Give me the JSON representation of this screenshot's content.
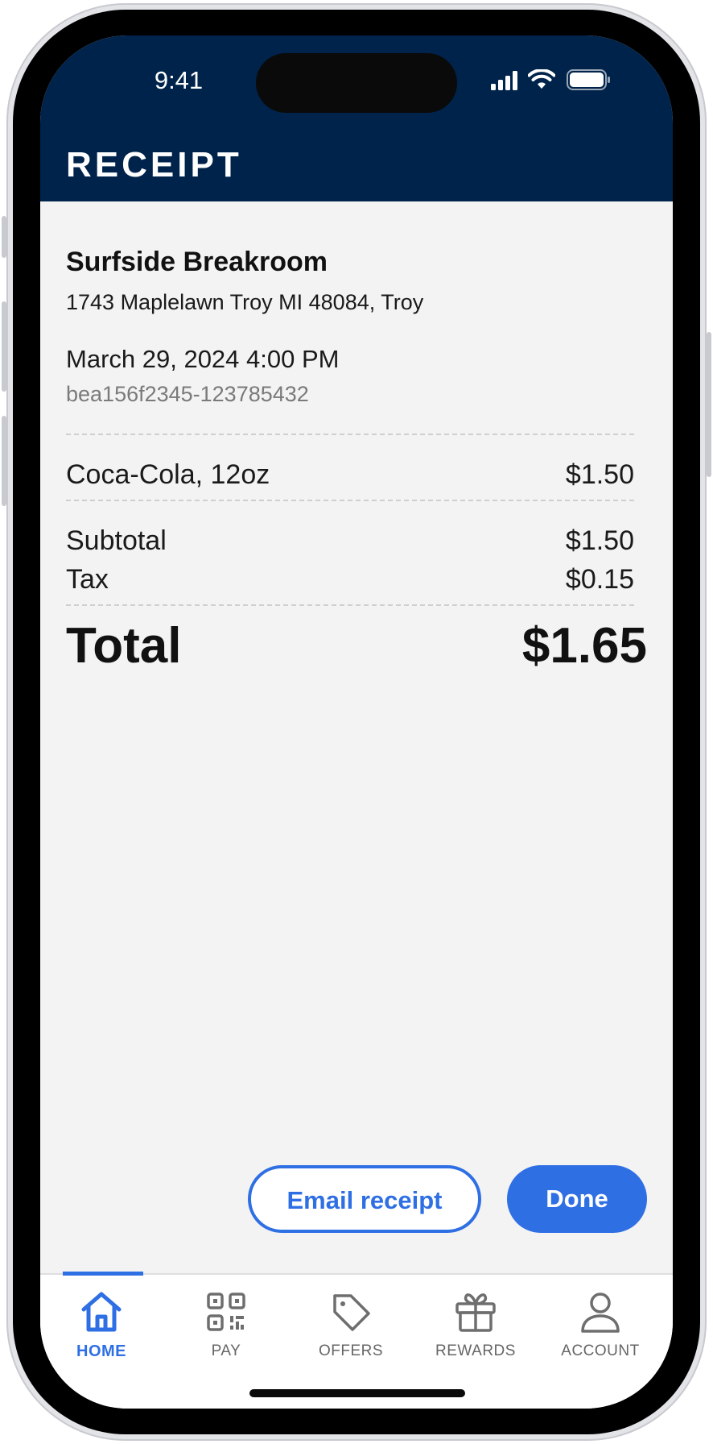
{
  "status_bar": {
    "time": "9:41",
    "icons": [
      "signal-icon",
      "wifi-icon",
      "battery-icon"
    ]
  },
  "header": {
    "title": "RECEIPT",
    "background_color": "#00234b"
  },
  "receipt": {
    "merchant_name": "Surfside Breakroom",
    "merchant_address": "1743 Maplelawn Troy MI 48084, Troy",
    "datetime": "March 29, 2024 4:00 PM",
    "transaction_id": "bea156f2345-123785432",
    "items": [
      {
        "name": "Coca-Cola, 12oz",
        "price": "$1.50"
      }
    ],
    "subtotal_label": "Subtotal",
    "subtotal_value": "$1.50",
    "tax_label": "Tax",
    "tax_value": "$0.15",
    "total_label": "Total",
    "total_value": "$1.65"
  },
  "actions": {
    "email_label": "Email receipt",
    "done_label": "Done",
    "accent_color": "#2f6fe4"
  },
  "bottom_nav": {
    "items": [
      {
        "label": "HOME",
        "icon": "home-icon",
        "active": true
      },
      {
        "label": "PAY",
        "icon": "qr-code-icon",
        "active": false
      },
      {
        "label": "OFFERS",
        "icon": "tag-icon",
        "active": false
      },
      {
        "label": "REWARDS",
        "icon": "gift-icon",
        "active": false
      },
      {
        "label": "ACCOUNT",
        "icon": "user-icon",
        "active": false
      }
    ]
  }
}
